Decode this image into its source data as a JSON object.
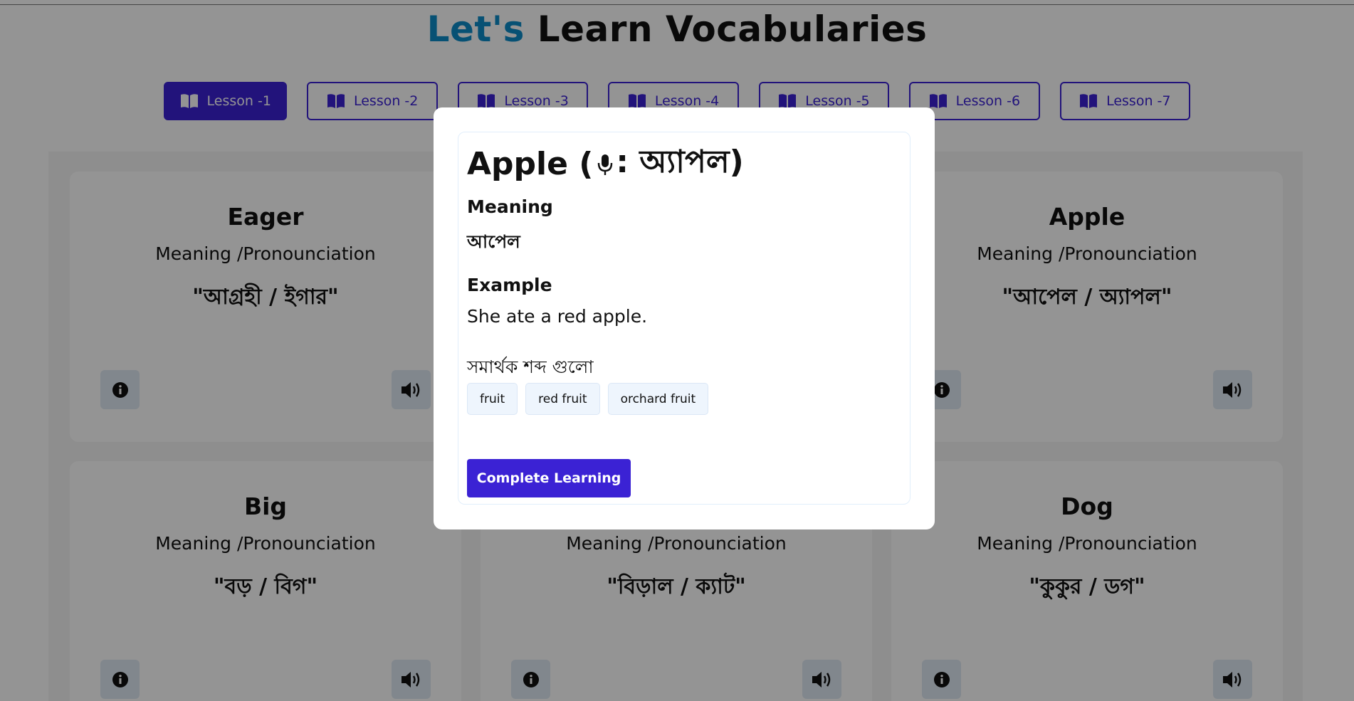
{
  "header": {
    "title_accent": "Let's",
    "title_rest": "Learn Vocabularies"
  },
  "lessons": [
    {
      "label": "Lesson -1",
      "active": true
    },
    {
      "label": "Lesson -2"
    },
    {
      "label": "Lesson -3"
    },
    {
      "label": "Lesson -4"
    },
    {
      "label": "Lesson -5"
    },
    {
      "label": "Lesson -6"
    },
    {
      "label": "Lesson -7"
    }
  ],
  "cards": [
    {
      "word": "Eager",
      "label": "Meaning /Pronounciation",
      "value": "\"আগ্রহী / ইগার\""
    },
    {
      "word": "Apple",
      "label": "Meaning /Pronounciation",
      "value": "\"আপেল / অ্যাপল\""
    },
    {
      "word": "Big",
      "label": "Meaning /Pronounciation",
      "value": "\"বড় / বিগ\""
    },
    {
      "word": "",
      "label": "Meaning /Pronounciation",
      "value": "\"বিড়াল / ক্যাট\""
    },
    {
      "word": "Dog",
      "label": "Meaning /Pronounciation",
      "value": "\"কুকুর / ডগ\""
    }
  ],
  "icons": {
    "lesson": "book-open-icon",
    "info": "info-icon",
    "speaker": "speaker-icon",
    "mic": "microphone-icon"
  },
  "modal": {
    "word": "Apple (",
    "pron": ": অ্যাপল)",
    "meaning_label": "Meaning",
    "meaning": "আপেল",
    "example_label": "Example",
    "example": "She ate a red apple.",
    "synonyms_label": "সমার্থক শব্দ গুলো",
    "synonyms": [
      "fruit",
      "red fruit",
      "orchard fruit"
    ],
    "complete_label": "Complete Learning"
  },
  "colors": {
    "accent_blue": "#0d8cc8",
    "primary_purple": "#3b22d4",
    "icon_button_bg": "#dfe9f3",
    "chip_bg": "#eef5fd"
  }
}
